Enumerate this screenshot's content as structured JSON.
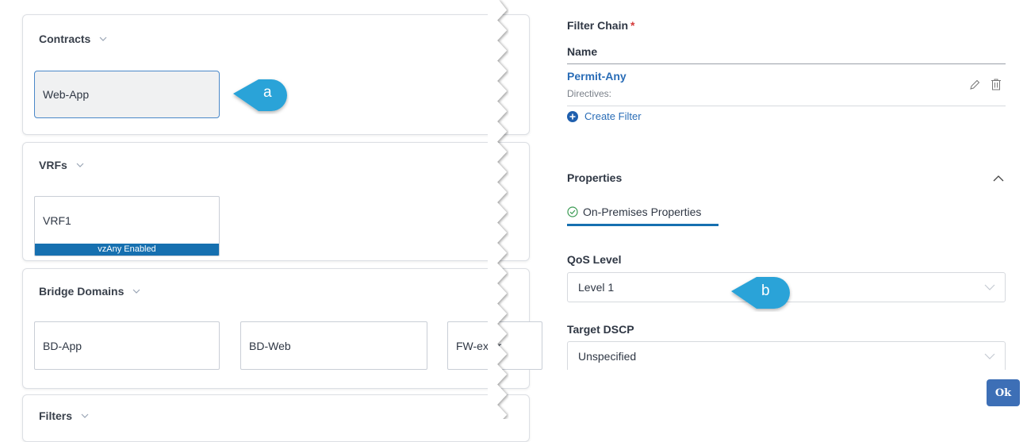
{
  "schema": {
    "contracts": {
      "title": "Contracts",
      "items": [
        "Web-App"
      ]
    },
    "vrfs": {
      "title": "VRFs",
      "items": [
        "VRF1"
      ],
      "vrf_badge": "vzAny Enabled"
    },
    "bridge_domains": {
      "title": "Bridge Domains",
      "items": [
        "BD-App",
        "BD-Web",
        "FW-exter"
      ]
    },
    "filters": {
      "title": "Filters"
    }
  },
  "callouts": {
    "a": "a",
    "b": "b"
  },
  "filter_chain": {
    "label": "Filter Chain",
    "required_mark": "*",
    "column_name": "Name",
    "rows": [
      {
        "name": "Permit-Any",
        "directives_label": "Directives:"
      }
    ],
    "create_filter": "Create Filter"
  },
  "properties": {
    "title": "Properties",
    "tab": "On-Premises Properties",
    "qos_label": "QoS Level",
    "qos_value": "Level 1",
    "dscp_label": "Target DSCP",
    "dscp_value": "Unspecified"
  },
  "ok_button": "Ok",
  "colors": {
    "accent": "#1670b0",
    "callout": "#2aa3d8",
    "link": "#2a6db7",
    "ok": "#3d6fb6"
  },
  "icons": [
    "chevron-down-icon",
    "pencil-icon",
    "trash-icon",
    "plus-circle-icon",
    "check-circle-icon",
    "chevron-up-icon"
  ]
}
